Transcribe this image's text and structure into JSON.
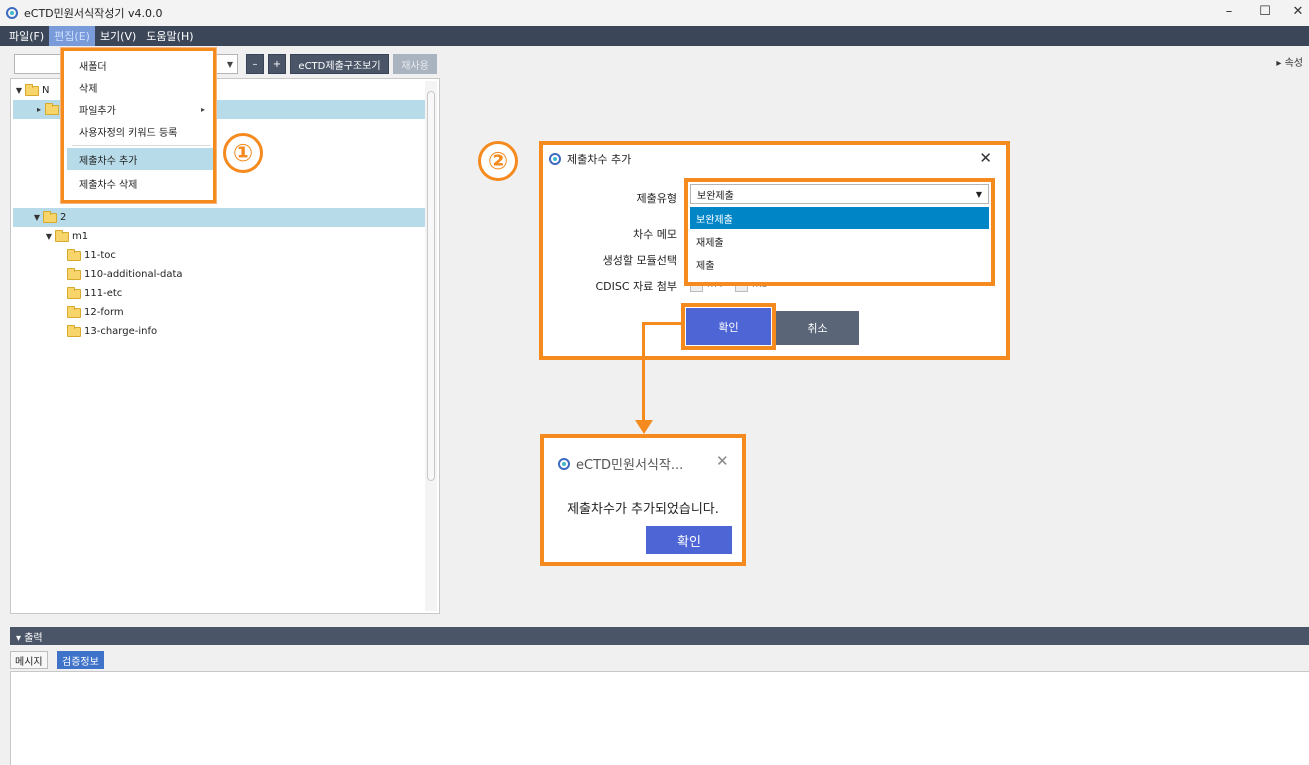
{
  "window": {
    "title": "eCTD민원서식작성기 v4.0.0",
    "minimize": "–",
    "maximize": "☐",
    "close": "✕"
  },
  "menubar": {
    "items": [
      "파일(F)",
      "편집(E)",
      "보기(V)",
      "도움말(H)"
    ]
  },
  "toolbar": {
    "remove": "–",
    "add": "+",
    "structure": "eCTD제출구조보기",
    "reuse": "재사용"
  },
  "properties_toggle": "▸ 속성",
  "tree": {
    "rows": [
      {
        "label": "N",
        "caret": "▼"
      },
      {
        "label": "",
        "caret": "▸"
      },
      {
        "label": "2",
        "caret": "▼"
      },
      {
        "label": "m1",
        "caret": "▼"
      },
      {
        "label": "11-toc",
        "caret": ""
      },
      {
        "label": "110-additional-data",
        "caret": ""
      },
      {
        "label": "111-etc",
        "caret": ""
      },
      {
        "label": "12-form",
        "caret": ""
      },
      {
        "label": "13-charge-info",
        "caret": ""
      }
    ]
  },
  "edit_menu": {
    "items": [
      "새폴더",
      "삭제",
      "파일추가",
      "사용자정의 키워드 등록",
      "제출차수 추가",
      "제출차수 삭제"
    ],
    "submenu_arrow": "▸"
  },
  "badges": {
    "one": "①",
    "two": "②"
  },
  "add_dialog": {
    "title": "제출차수 추가",
    "close": "✕",
    "labels": {
      "type": "제출유형",
      "memo": "차수 메모",
      "module": "생성할 모듈선택",
      "cdisc": "CDISC 자료 첨부"
    },
    "type_selected": "보완제출",
    "type_options": [
      "보완제출",
      "재제출",
      "제출"
    ],
    "cdisc_options": [
      "m4",
      "m5"
    ],
    "ok": "확인",
    "cancel": "취소"
  },
  "confirm_dialog": {
    "title": "eCTD민원서식작...",
    "close": "✕",
    "message": "제출차수가 추가되었습니다.",
    "ok": "확인"
  },
  "output": {
    "header": "▾ 출력",
    "tabs": [
      "메시지",
      "검증정보"
    ]
  },
  "colors": {
    "accent": "#f58a1f",
    "menubar": "#3b4658",
    "primary_button": "#4e65d6",
    "selection": "#b7dbe8",
    "option_highlight": "#0085c7"
  }
}
